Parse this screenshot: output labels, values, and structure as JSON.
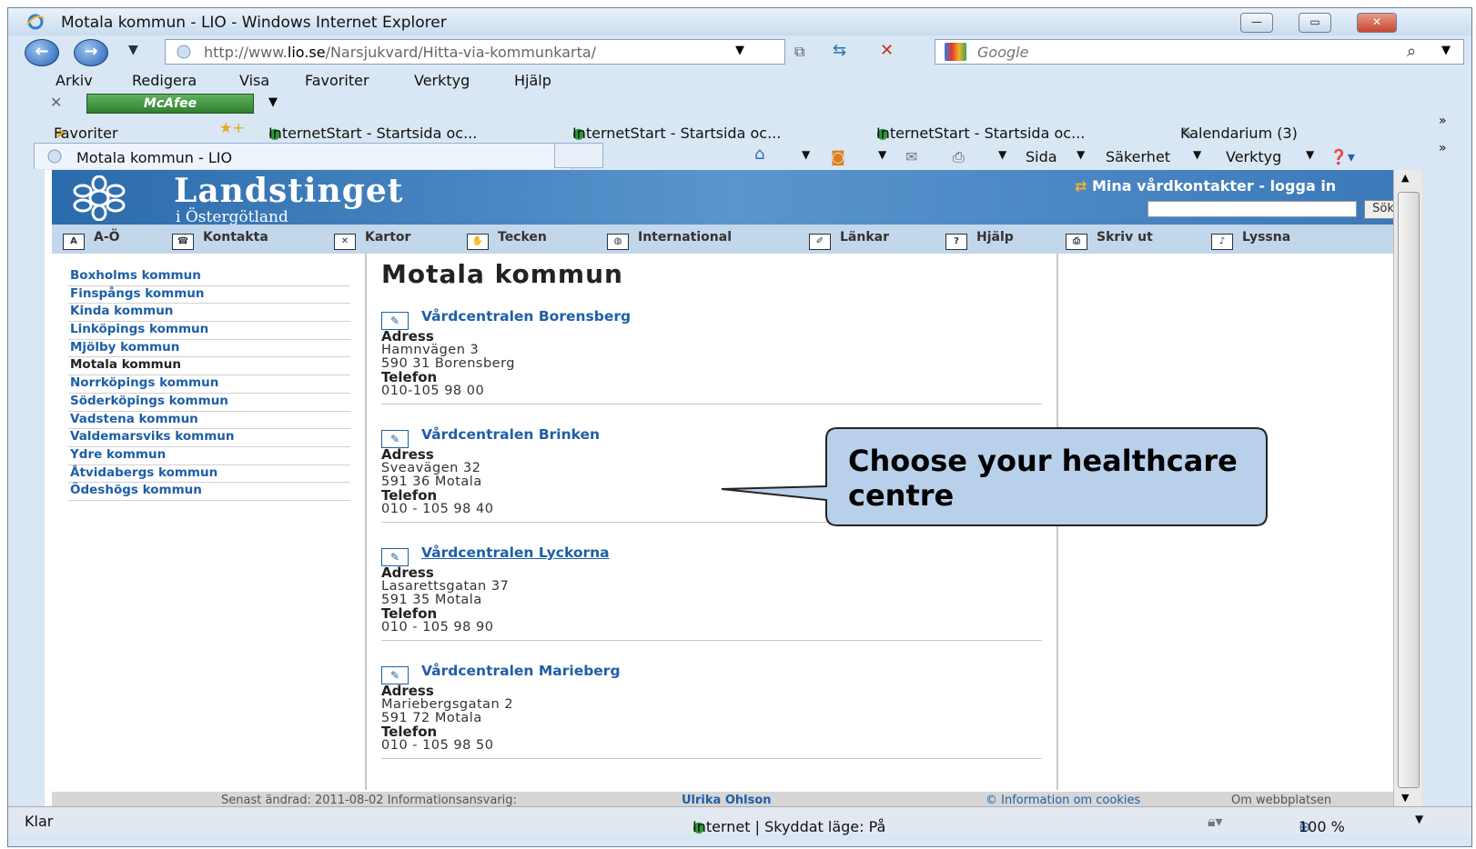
{
  "window": {
    "title": "Motala kommun - LIO - Windows Internet Explorer"
  },
  "browser": {
    "url_prefix": "http://www.",
    "url_domain": "lio.se",
    "url_path": "/Narsjukvard/Hitta-via-kommunkarta/",
    "search_placeholder": "Google",
    "menu": [
      "Arkiv",
      "Redigera",
      "Visa",
      "Favoriter",
      "Verktyg",
      "Hjälp"
    ],
    "mcafee_label": "McAfee",
    "favorites_label": "Favoriter",
    "favorites": [
      "InternetStart - Startsida oc...",
      "InternetStart - Startsida oc...",
      "InternetStart - Startsida oc...",
      "Kalendarium (3)"
    ],
    "tab_title": "Motala kommun - LIO",
    "commands": [
      "Sida",
      "Säkerhet",
      "Verktyg"
    ],
    "status_left": "Klar",
    "status_zone": "Internet | Skyddat läge: På",
    "zoom": "100 %"
  },
  "site": {
    "logo_main": "Landstinget",
    "logo_sub": "i Östergötland",
    "login_label": "Mina vårdkontakter - logga in",
    "search_button": "Sök",
    "toolbar": [
      "A-Ö",
      "Kontakta",
      "Kartor",
      "Tecken",
      "International",
      "Länkar",
      "Hjälp",
      "Skriv ut",
      "Lyssna"
    ],
    "municipalities": [
      "Boxholms kommun",
      "Finspångs kommun",
      "Kinda kommun",
      "Linköpings kommun",
      "Mjölby kommun",
      "Motala kommun",
      "Norrköpings kommun",
      "Söderköpings kommun",
      "Vadstena kommun",
      "Valdemarsviks kommun",
      "Ydre kommun",
      "Åtvidabergs kommun",
      "Ödeshögs kommun"
    ],
    "current_municipality": "Motala kommun",
    "page_title": "Motala kommun",
    "address_label": "Adress",
    "phone_label": "Telefon",
    "centres": [
      {
        "name": "Vårdcentralen Borensberg",
        "street": "Hamnvägen 3",
        "postal": "590 31 Borensberg",
        "phone": "010-105 98 00"
      },
      {
        "name": "Vårdcentralen Brinken",
        "street": "Sveavägen 32",
        "postal": "591 36 Motala",
        "phone": "010 - 105 98 40"
      },
      {
        "name": "Vårdcentralen Lyckorna",
        "street": "Lasarettsgatan 37",
        "postal": "591 35 Motala",
        "phone": "010 - 105 98 90"
      },
      {
        "name": "Vårdcentralen Marieberg",
        "street": "Mariebergsgatan 2",
        "postal": "591 72 Motala",
        "phone": "010 - 105 98 50"
      }
    ],
    "footer_changed": "Senast ändrad: 2011-08-02 Informationsansvarig:",
    "footer_person": "Ulrika Ohlson",
    "footer_cookies": "© Information om cookies",
    "footer_about": "Om webbplatsen"
  },
  "annotation": {
    "line1": "Choose your healthcare",
    "line2": "centre"
  },
  "colors": {
    "link": "#1d5fa6",
    "callout_fill": "#b9d0ea",
    "banner": "#2b6bab"
  }
}
